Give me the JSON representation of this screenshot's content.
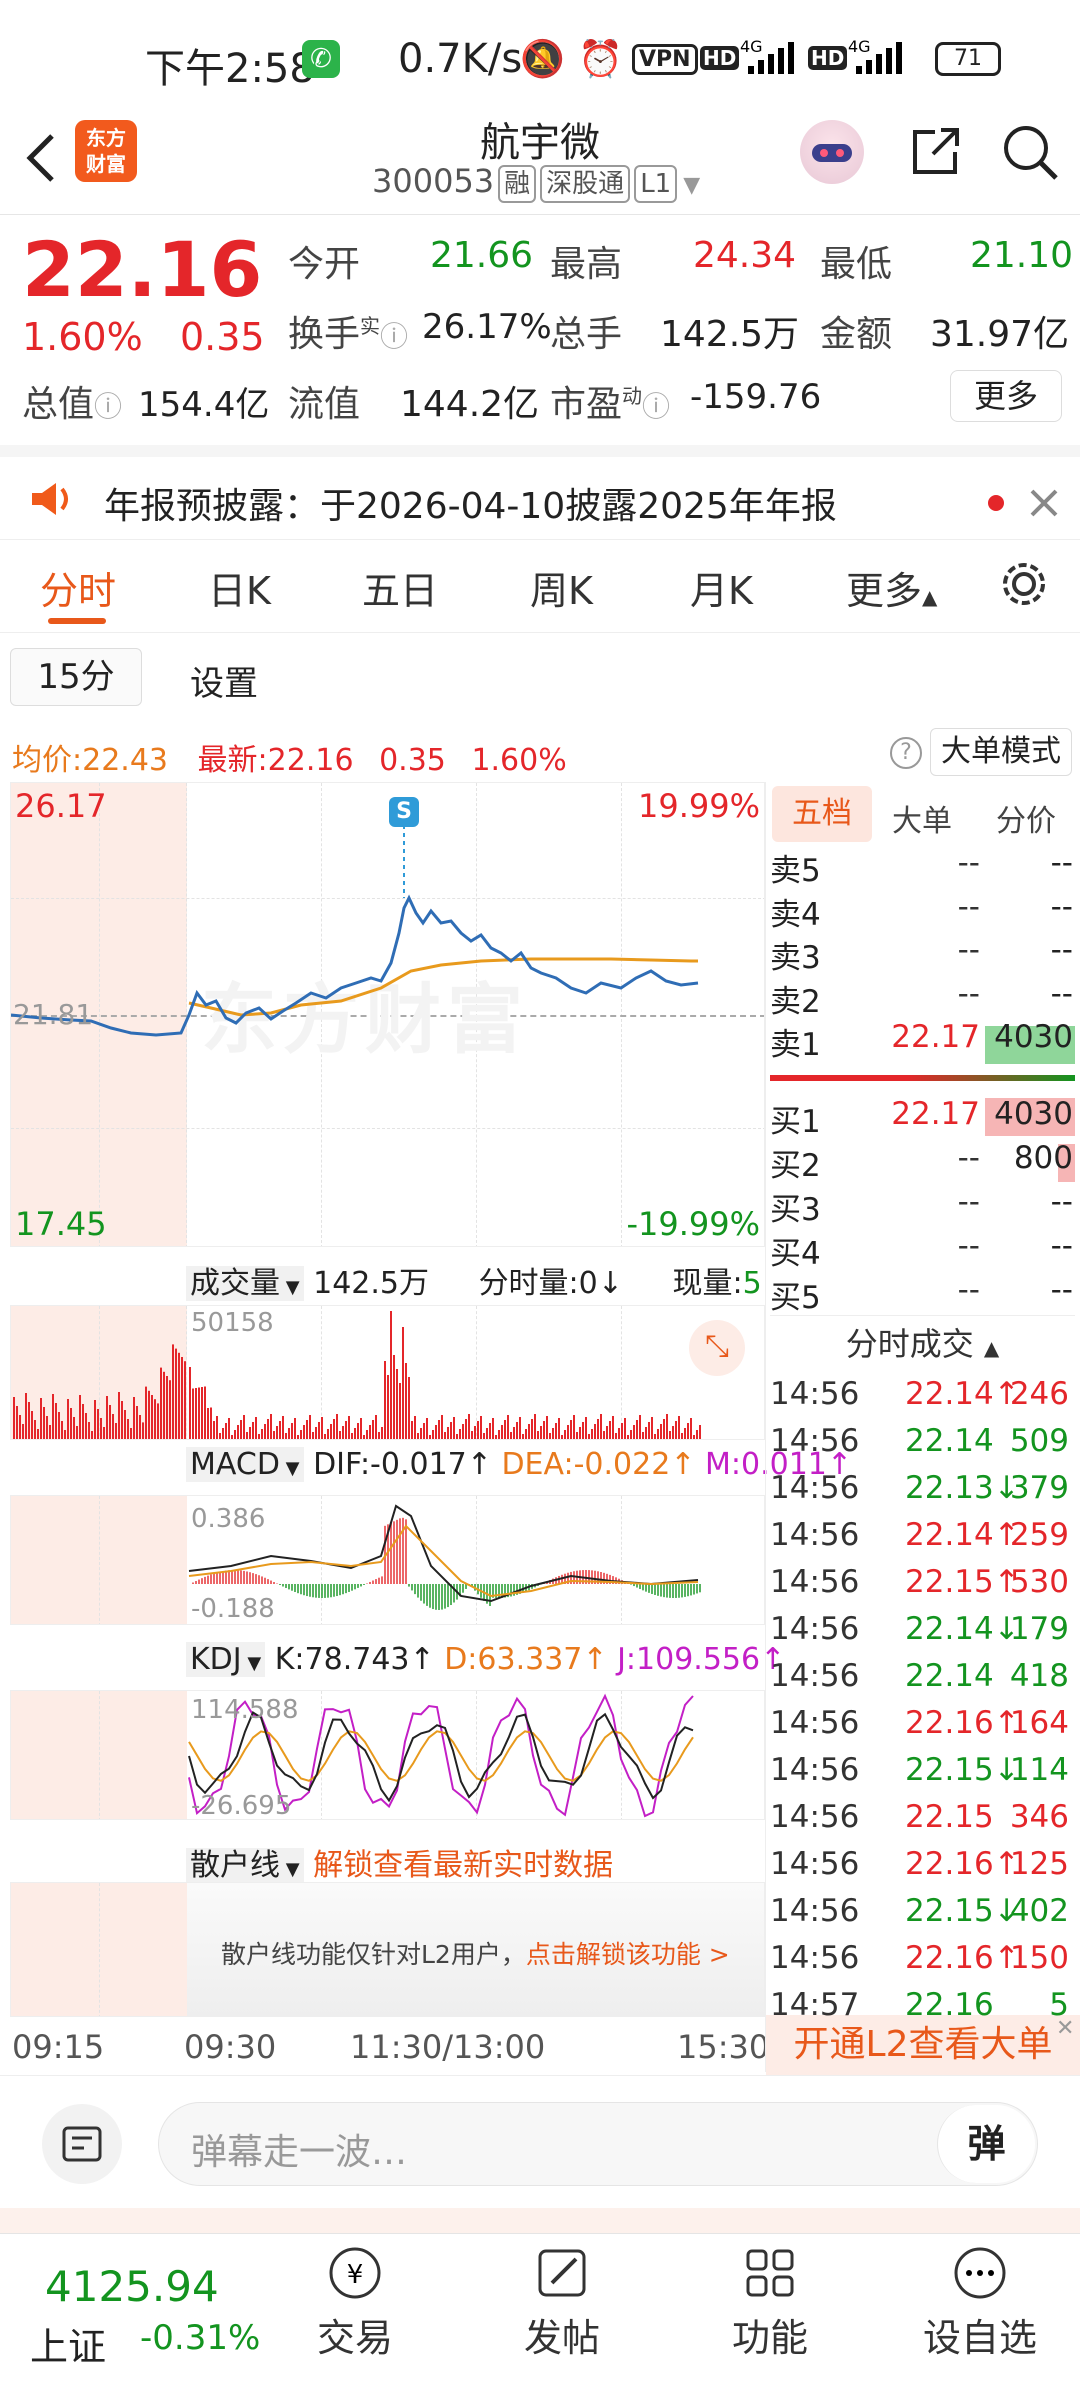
{
  "status_bar": {
    "time": "下午2:58",
    "speed": "0.7K/s",
    "vpn": "VPN",
    "hd": "HD",
    "net": "4G",
    "battery": "71"
  },
  "header": {
    "logo_text_1": "东方",
    "logo_text_2": "财富",
    "stock_name": "航宇微",
    "stock_code": "300053",
    "tag_margin": "融",
    "tag_connect": "深股通",
    "tag_level": "L1"
  },
  "quote": {
    "price": "22.16",
    "change_pct": "1.60%",
    "change": "0.35",
    "open_label": "今开",
    "open": "21.66",
    "high_label": "最高",
    "high": "24.34",
    "low_label": "最低",
    "low": "21.10",
    "turnover_label": "换手",
    "turnover_sup": "实",
    "turnover": "26.17%",
    "volume_label": "总手",
    "volume": "142.5万",
    "amount_label": "金额",
    "amount": "31.97亿",
    "mktcap_label": "总值",
    "mktcap": "154.4亿",
    "float_label": "流值",
    "float_cap": "144.2亿",
    "pe_label": "市盈",
    "pe_sup": "动",
    "pe": "-159.76",
    "more": "更多"
  },
  "notice": {
    "text": "年报预披露：于2026-04-10披露2025年年报"
  },
  "tabs": {
    "items": [
      "分时",
      "日K",
      "五日",
      "周K",
      "月K",
      "更多"
    ],
    "active": "分时"
  },
  "subbar": {
    "interval": "15分",
    "settings": "设置"
  },
  "infoline": {
    "avg_label": "均价:",
    "avg": "22.43",
    "latest_label": "最新:",
    "latest": "22.16",
    "chg": "0.35",
    "pct": "1.60%",
    "big_mode": "大单模式"
  },
  "chart": {
    "max_price": "26.17",
    "min_price": "17.45",
    "ref_price": "21.81",
    "max_pct": "19.99%",
    "min_pct": "-19.99%",
    "s_marker": "S",
    "watermark": "东方财富"
  },
  "volume": {
    "label": "成交量",
    "total": "142.5万",
    "minute_label": "分时量:0↓",
    "now_label": "现量:",
    "now": "5",
    "max": "50158"
  },
  "macd": {
    "label": "MACD",
    "dif": "DIF:-0.017↑",
    "dea": "DEA:-0.022↑",
    "m": "M:0.011↑",
    "top": "0.386",
    "bottom": "-0.188"
  },
  "kdj": {
    "label": "KDJ",
    "k": "K:78.743↑",
    "d": "D:63.337↑",
    "j": "J:109.556↑",
    "top": "114.588",
    "bottom": "-26.695"
  },
  "retail": {
    "label": "散户线",
    "unlock": "解锁查看最新实时数据",
    "note": "散户线功能仅针对L2用户，",
    "link": "点击解锁该功能 >"
  },
  "time_axis": [
    "09:15",
    "09:30",
    "11:30/13:00",
    "15:30"
  ],
  "orderbook": {
    "tabs": [
      "五档",
      "大单",
      "分价"
    ],
    "asks": [
      {
        "n": "卖5",
        "p": "--",
        "v": "--"
      },
      {
        "n": "卖4",
        "p": "--",
        "v": "--"
      },
      {
        "n": "卖3",
        "p": "--",
        "v": "--"
      },
      {
        "n": "卖2",
        "p": "--",
        "v": "--"
      },
      {
        "n": "卖1",
        "p": "22.17",
        "v": "4030"
      }
    ],
    "bids": [
      {
        "n": "买1",
        "p": "22.17",
        "v": "4030"
      },
      {
        "n": "买2",
        "p": "--",
        "v": "800"
      },
      {
        "n": "买3",
        "p": "--",
        "v": "--"
      },
      {
        "n": "买4",
        "p": "--",
        "v": "--"
      },
      {
        "n": "买5",
        "p": "--",
        "v": "--"
      }
    ]
  },
  "ticks": {
    "title": "分时成交",
    "rows": [
      {
        "t": "14:56",
        "p": "22.14↑",
        "v": "246",
        "c": "red"
      },
      {
        "t": "14:56",
        "p": "22.14",
        "v": "509",
        "c": "green"
      },
      {
        "t": "14:56",
        "p": "22.13↓",
        "v": "379",
        "c": "green"
      },
      {
        "t": "14:56",
        "p": "22.14↑",
        "v": "259",
        "c": "red"
      },
      {
        "t": "14:56",
        "p": "22.15↑",
        "v": "530",
        "c": "red"
      },
      {
        "t": "14:56",
        "p": "22.14↓",
        "v": "179",
        "c": "green"
      },
      {
        "t": "14:56",
        "p": "22.14",
        "v": "418",
        "c": "green"
      },
      {
        "t": "14:56",
        "p": "22.16↑",
        "v": "164",
        "c": "red"
      },
      {
        "t": "14:56",
        "p": "22.15↓",
        "v": "114",
        "c": "green"
      },
      {
        "t": "14:56",
        "p": "22.15",
        "v": "346",
        "c": "red"
      },
      {
        "t": "14:56",
        "p": "22.16↑",
        "v": "125",
        "c": "red"
      },
      {
        "t": "14:56",
        "p": "22.15↓",
        "v": "402",
        "c": "green"
      },
      {
        "t": "14:56",
        "p": "22.16↑",
        "v": "150",
        "c": "red"
      },
      {
        "t": "14:57",
        "p": "22.16",
        "v": "5",
        "c": "green"
      }
    ]
  },
  "l2_banner": "开通L2查看大单",
  "danmu": {
    "placeholder": "弹幕走一波…",
    "button": "弹"
  },
  "bottom_nav": {
    "index_value": "4125.94",
    "index_name": "上证",
    "index_pct": "-0.31%",
    "items": [
      "交易",
      "发帖",
      "功能",
      "设自选"
    ]
  },
  "colors": {
    "up": "#e4262a",
    "down": "#13941f",
    "accent": "#e8581a",
    "avg_line": "#e89a1d",
    "price_line": "#2f6db5"
  }
}
